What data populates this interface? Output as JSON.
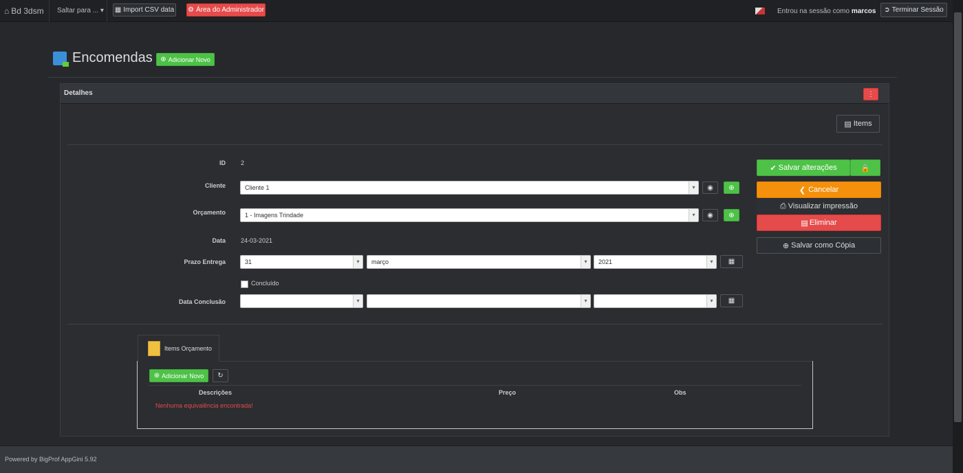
{
  "navbar": {
    "brand": "Bd 3dsm",
    "jump_label": "Saltar para ...",
    "import_label": "Import CSV data",
    "admin_label": "Área do Administrador",
    "session_text": "Entrou na sessão como",
    "session_user": "marcos",
    "logout_label": "Terminar Sessão"
  },
  "page": {
    "title": "Encomendas",
    "add_new_label": "Adicionar Novo"
  },
  "panel": {
    "title": "Detalhes",
    "items_button": "Items"
  },
  "form": {
    "id_label": "ID",
    "id_value": "2",
    "cliente_label": "Cliente",
    "cliente_value": "Cliente 1",
    "orcamento_label": "Orçamento",
    "orcamento_value": "1 - Imagens Trindade",
    "data_label": "Data",
    "data_value": "24-03-2021",
    "prazo_label": "Prazo Entrega",
    "prazo_day": "31",
    "prazo_month": "março",
    "prazo_year": "2021",
    "concluido_label": "Concluído",
    "data_conclusao_label": "Data Conclusão"
  },
  "actions": {
    "save": "Salvar alterações",
    "cancel": "Cancelar",
    "print": "Visualizar impressão",
    "delete": "Eliminar",
    "save_copy": "Salvar como Cópia"
  },
  "tab": {
    "label": "Items Orçamento",
    "add_new": "Adicionar Novo",
    "columns": [
      "Descrições",
      "Preço",
      "Obs"
    ],
    "empty_message": "Nenhuma equivalência encontrada!"
  },
  "footer": {
    "text": "Powered by BigProf AppGini 5.92"
  },
  "colors": {
    "green": "#4dc247",
    "red": "#e54b4b",
    "orange": "#f5900c"
  }
}
